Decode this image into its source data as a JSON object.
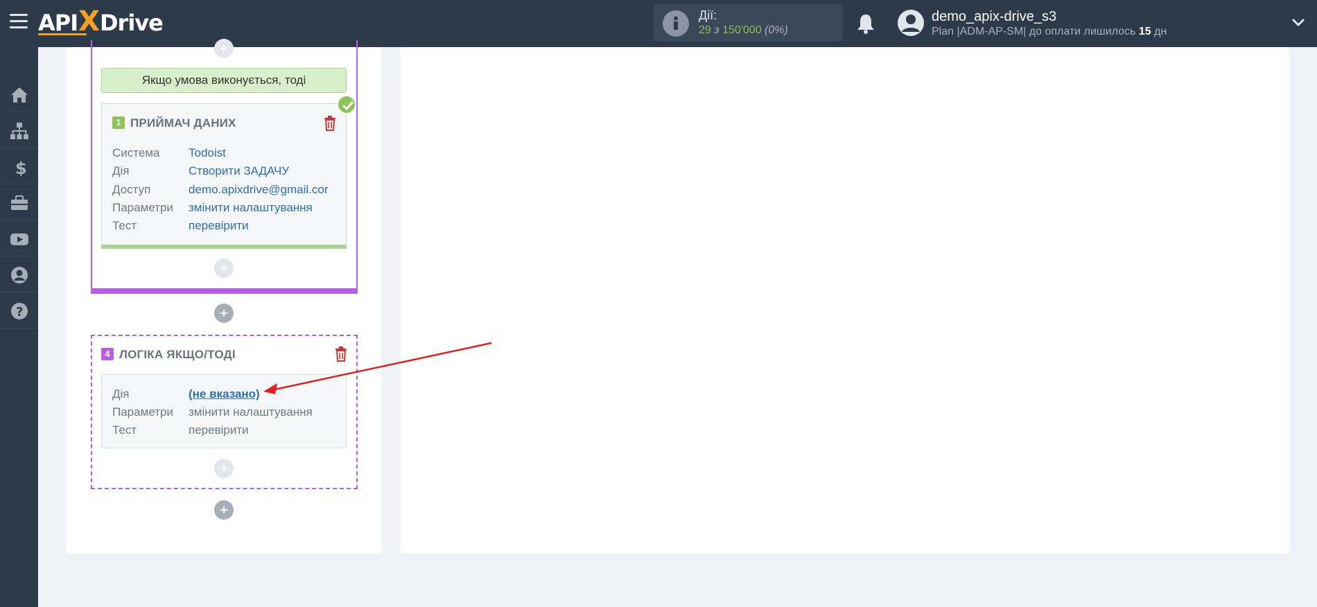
{
  "header": {
    "logo": "APIXDrive",
    "actions_label": "Дії:",
    "actions_used": "29",
    "actions_sep": "з",
    "actions_total": "150'000",
    "actions_pct": "(0%)",
    "user_name": "demo_apix-drive_s3",
    "plan_prefix": "Plan |ADM-AP-SM| до оплати лишилось",
    "plan_days": "15",
    "plan_suffix": "дн"
  },
  "sidebar": {
    "items": [
      {
        "icon": "home-icon"
      },
      {
        "icon": "sitemap-icon"
      },
      {
        "icon": "dollar-icon"
      },
      {
        "icon": "briefcase-icon"
      },
      {
        "icon": "youtube-icon"
      },
      {
        "icon": "user-circle-icon"
      },
      {
        "icon": "question-icon"
      }
    ]
  },
  "flow": {
    "condition_header": "Якщо умова виконується, тоді",
    "receiver": {
      "number": "1",
      "title": "ПРИЙМАЧ ДАНИХ",
      "rows": [
        {
          "label": "Система",
          "value": "Todoist"
        },
        {
          "label": "Дія",
          "value": "Створити ЗАДАЧУ"
        },
        {
          "label": "Доступ",
          "value": "demo.apixdrive@gmail.cor"
        },
        {
          "label": "Параметри",
          "value": "змінити налаштування"
        },
        {
          "label": "Тест",
          "value": "перевірити"
        }
      ]
    },
    "logic": {
      "number": "4",
      "title": "ЛОГІКА ЯКЩО/ТОДІ",
      "rows": [
        {
          "label": "Дія",
          "value": "(не вказано)"
        },
        {
          "label": "Параметри",
          "value": "змінити налаштування"
        },
        {
          "label": "Тест",
          "value": "перевірити"
        }
      ]
    }
  },
  "colors": {
    "topbar": "#2d3a4a",
    "accent_orange": "#f7a21b",
    "purple": "#b85ee6",
    "green": "#8ec45a",
    "link_blue": "#2d6fb5",
    "trash_red": "#d0342c",
    "arrow_red": "#e02020"
  }
}
